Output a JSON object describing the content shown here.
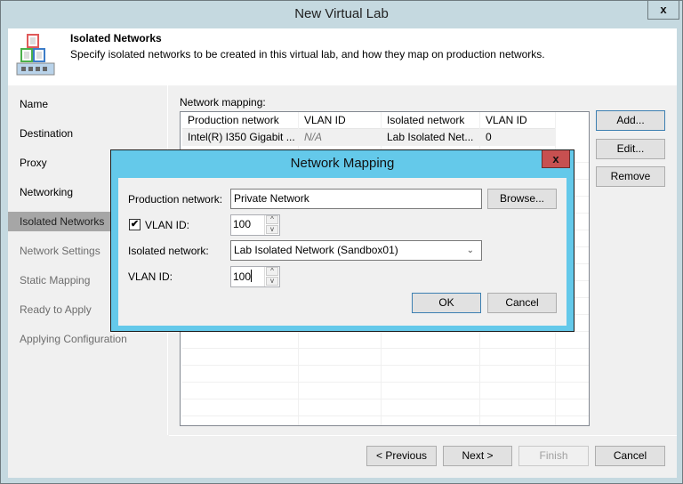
{
  "window": {
    "title": "New Virtual Lab",
    "close_label": "x"
  },
  "header": {
    "title": "Isolated Networks",
    "description": "Specify isolated networks to be created in this virtual lab, and how they map on production networks.",
    "icon": "virtual-lab-network-icon"
  },
  "sidebar": {
    "steps": [
      {
        "label": "Name",
        "state": "done"
      },
      {
        "label": "Destination",
        "state": "done"
      },
      {
        "label": "Proxy",
        "state": "done"
      },
      {
        "label": "Networking",
        "state": "done"
      },
      {
        "label": "Isolated Networks",
        "state": "active"
      },
      {
        "label": "Network Settings",
        "state": "future"
      },
      {
        "label": "Static Mapping",
        "state": "future"
      },
      {
        "label": "Ready to Apply",
        "state": "future"
      },
      {
        "label": "Applying Configuration",
        "state": "future"
      }
    ]
  },
  "content": {
    "mapping_label": "Network mapping:",
    "columns": [
      "Production network",
      "VLAN ID",
      "Isolated network",
      "VLAN ID"
    ],
    "rows": [
      [
        "Intel(R) I350 Gigabit ...",
        "N/A",
        "Lab Isolated Net...",
        "0"
      ]
    ],
    "buttons": {
      "add": "Add...",
      "edit": "Edit...",
      "remove": "Remove"
    }
  },
  "footer": {
    "previous": "< Previous",
    "next": "Next >",
    "finish": "Finish",
    "cancel": "Cancel"
  },
  "modal": {
    "title": "Network Mapping",
    "close_label": "x",
    "production_network_label": "Production network:",
    "production_network_value": "Private Network",
    "browse": "Browse...",
    "vlan_checkbox_label": "VLAN ID:",
    "vlan_checked": true,
    "vlan_value": "100",
    "isolated_network_label": "Isolated network:",
    "isolated_network_value": "Lab Isolated Network (Sandbox01)",
    "isolated_vlan_label": "VLAN ID:",
    "isolated_vlan_value": "100",
    "ok": "OK",
    "cancel": "Cancel"
  }
}
